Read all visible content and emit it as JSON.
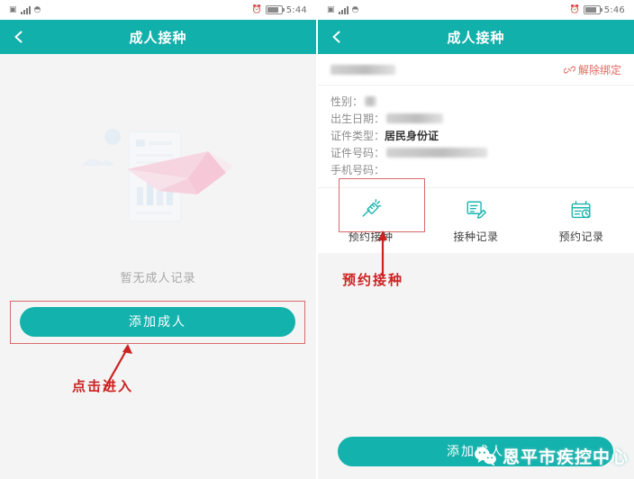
{
  "theme": {
    "teal": "#12b0ab",
    "button_teal": "#13b2ad",
    "annotation_red": "#cc2222",
    "annotation_box_red": "#d96a6a",
    "unbind_red": "#e2685f",
    "page_bg": "#f4f4f4",
    "card_bg": "#ffffff"
  },
  "left_phone": {
    "status_bar": {
      "time": "5:44",
      "icons": [
        "sim-card-icon",
        "signal-bars-icon",
        "wifi-icon",
        "alarm-clock-icon",
        "battery-icon"
      ]
    },
    "nav": {
      "back_icon": "chevron-left-icon",
      "title": "成人接种"
    },
    "empty_state": {
      "illustration": "paper-plane-document-illustration",
      "message": "暂无成人记录"
    },
    "add_button": {
      "label": "添加成人"
    },
    "annotation": {
      "label": "点击进入"
    }
  },
  "right_phone": {
    "status_bar": {
      "time": "5:46",
      "icons": [
        "sim-card-icon",
        "signal-bars-icon",
        "wifi-icon",
        "alarm-clock-icon",
        "battery-icon"
      ]
    },
    "nav": {
      "back_icon": "chevron-left-icon",
      "title": "成人接种"
    },
    "profile_card": {
      "name_value": "",
      "name_redacted": true,
      "unbind": {
        "icon": "broken-link-icon",
        "label": "解除绑定"
      },
      "fields": [
        {
          "label": "性别：",
          "value": "",
          "redacted": true,
          "strong": false
        },
        {
          "label": "出生日期：",
          "value": "",
          "redacted": true,
          "strong": false
        },
        {
          "label": "证件类型：",
          "value": "居民身份证",
          "redacted": false,
          "strong": true
        },
        {
          "label": "证件号码：",
          "value": "",
          "redacted": true,
          "strong": false
        },
        {
          "label": "手机号码：",
          "value": "",
          "redacted": false,
          "strong": false
        }
      ]
    },
    "tiles": [
      {
        "icon": "syringe-icon",
        "label": "预约接种",
        "highlighted": true
      },
      {
        "icon": "record-edit-icon",
        "label": "接种记录",
        "highlighted": false
      },
      {
        "icon": "calendar-clock-icon",
        "label": "预约记录",
        "highlighted": false
      }
    ],
    "annotation": {
      "label": "预约接种"
    },
    "add_button": {
      "label": "添加成人"
    },
    "watermark": {
      "logo": "wechat-logo-icon",
      "text": "恩平市疾控中心"
    }
  }
}
